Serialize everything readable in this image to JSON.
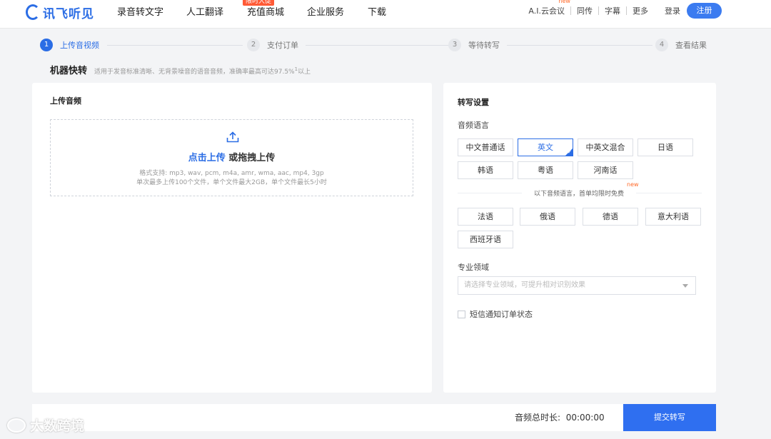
{
  "nav": {
    "logo": "讯飞听见",
    "items": [
      "录音转文字",
      "人工翻译",
      "充值商城",
      "企业服务",
      "下载"
    ],
    "badge": "限时大促",
    "right_links": [
      "A.I.云会议",
      "同传",
      "字幕",
      "更多"
    ],
    "new_tag": "new",
    "login": "登录",
    "register": "注册"
  },
  "steps": [
    {
      "num": "1",
      "label": "上传音视频"
    },
    {
      "num": "2",
      "label": "支付订单"
    },
    {
      "num": "3",
      "label": "等待转写"
    },
    {
      "num": "4",
      "label": "查看结果"
    }
  ],
  "heading": {
    "title": "机器快转",
    "subtitle": "适用于发音标准清晰、无背景噪音的语音音频，准确率最高可达97.5%",
    "sup": "1",
    "suffix": "以上"
  },
  "upload": {
    "title": "上传音频",
    "click": "点击上传",
    "drag": "或拖拽上传",
    "formats": "格式支持: mp3, wav, pcm, m4a, amr, wma, aac, mp4, 3gp",
    "limits": "单次最多上传100个文件，单个文件最大2GB，单个文件最长5小时"
  },
  "settings": {
    "title": "转写设置",
    "lang_label": "音频语言",
    "languages": [
      "中文普通话",
      "英文",
      "中英文混合",
      "日语",
      "韩语",
      "粤语",
      "河南话"
    ],
    "selected": "英文",
    "divider_text": "以下音频语言，首单均限时免费",
    "new": "new",
    "free_languages": [
      "法语",
      "俄语",
      "德语",
      "意大利语",
      "西班牙语"
    ],
    "domain_label": "专业领域",
    "domain_placeholder": "请选择专业领域，可提升相对识别效果",
    "sms_label": "短信通知订单状态"
  },
  "bottom": {
    "duration_label": "音频总时长:",
    "duration_value": "00:00:00",
    "submit": "提交转写"
  },
  "watermark": "大数跨境"
}
